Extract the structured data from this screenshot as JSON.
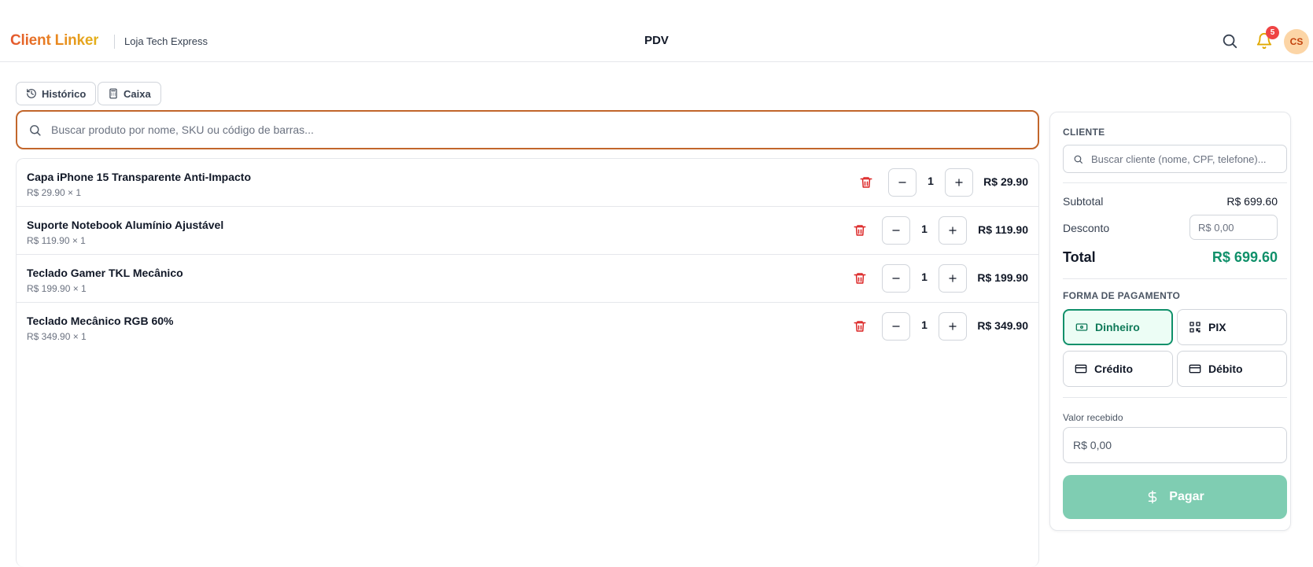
{
  "header": {
    "brand": "Client Linker",
    "store_name": "Loja Tech Express",
    "page_title": "PDV",
    "notification_count": "5",
    "avatar_initials": "CS",
    "brand_colors": [
      "#e4572e",
      "#e98a1f",
      "#e3b31c"
    ]
  },
  "toolbar": {
    "history_label": "Histórico",
    "cash_label": "Caixa"
  },
  "product_search": {
    "placeholder": "Buscar produto por nome, SKU ou código de barras...",
    "value": ""
  },
  "cart": {
    "items": [
      {
        "name": "Capa iPhone 15 Transparente Anti-Impacto",
        "unit_line": "R$ 29.90 × 1",
        "quantity": "1",
        "total": "R$ 29.90"
      },
      {
        "name": "Suporte Notebook Alumínio Ajustável",
        "unit_line": "R$ 119.90 × 1",
        "quantity": "1",
        "total": "R$ 119.90"
      },
      {
        "name": "Teclado Gamer TKL Mecânico",
        "unit_line": "R$ 199.90 × 1",
        "quantity": "1",
        "total": "R$ 199.90"
      },
      {
        "name": "Teclado Mecânico RGB 60%",
        "unit_line": "R$ 349.90 × 1",
        "quantity": "1",
        "total": "R$ 349.90"
      }
    ]
  },
  "sidebar": {
    "customer_label": "CLIENTE",
    "customer_search_placeholder": "Buscar cliente (nome, CPF, telefone)...",
    "subtotal_label": "Subtotal",
    "subtotal_value": "R$ 699.60",
    "discount_label": "Desconto",
    "discount_placeholder": "R$ 0,00",
    "total_label": "Total",
    "total_value": "R$ 699.60",
    "payment_label": "FORMA DE PAGAMENTO",
    "payment_methods": {
      "cash": "Dinheiro",
      "pix": "PIX",
      "credit": "Crédito",
      "debit": "Débito"
    },
    "selected_payment": "Dinheiro",
    "received_label": "Valor recebido",
    "received_placeholder": "R$ 0,00",
    "pay_button": "Pagar"
  },
  "colors": {
    "accent_orange": "#c2662b",
    "success_green": "#10906a",
    "pay_button_bg": "#7fcdb2",
    "danger_red": "#dc2626"
  }
}
